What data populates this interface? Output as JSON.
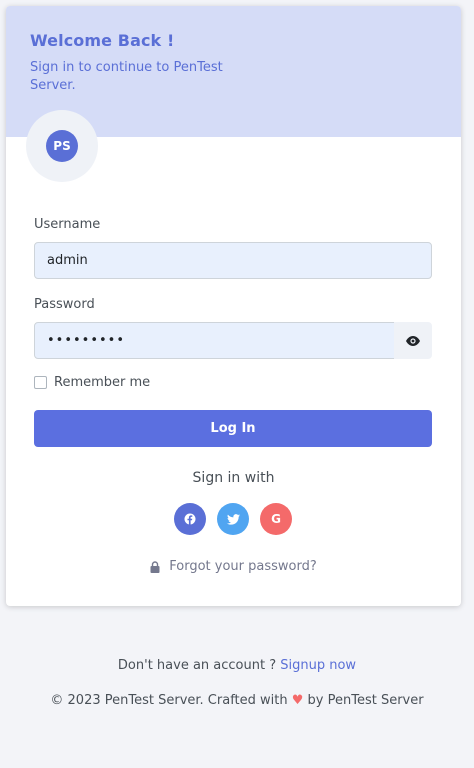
{
  "header": {
    "title": "Welcome Back !",
    "subtitle": "Sign in to continue to PenTest Server."
  },
  "avatar": {
    "initials": "PS"
  },
  "form": {
    "username_label": "Username",
    "username_value": "admin",
    "password_label": "Password",
    "password_value": "•••••••••",
    "remember_label": "Remember me",
    "remember_checked": false,
    "login_label": "Log In"
  },
  "social": {
    "heading": "Sign in with",
    "buttons": [
      {
        "name": "facebook",
        "icon": "facebook-icon"
      },
      {
        "name": "twitter",
        "icon": "twitter-icon"
      },
      {
        "name": "google",
        "icon": "google-icon",
        "glyph": "G"
      }
    ]
  },
  "forgot": {
    "label": "Forgot your password?",
    "icon": "lock-icon"
  },
  "footer": {
    "signup_prompt": "Don't have an account ? ",
    "signup_link": "Signup now",
    "copyright_prefix": "© 2023 PenTest Server. Crafted with ",
    "copyright_suffix": " by PenTest Server"
  },
  "colors": {
    "accent": "#5a6fd6",
    "header_bg": "#d5dcf7",
    "facebook": "#5a6fd6",
    "twitter": "#50a5f1",
    "google": "#f46a6a"
  }
}
